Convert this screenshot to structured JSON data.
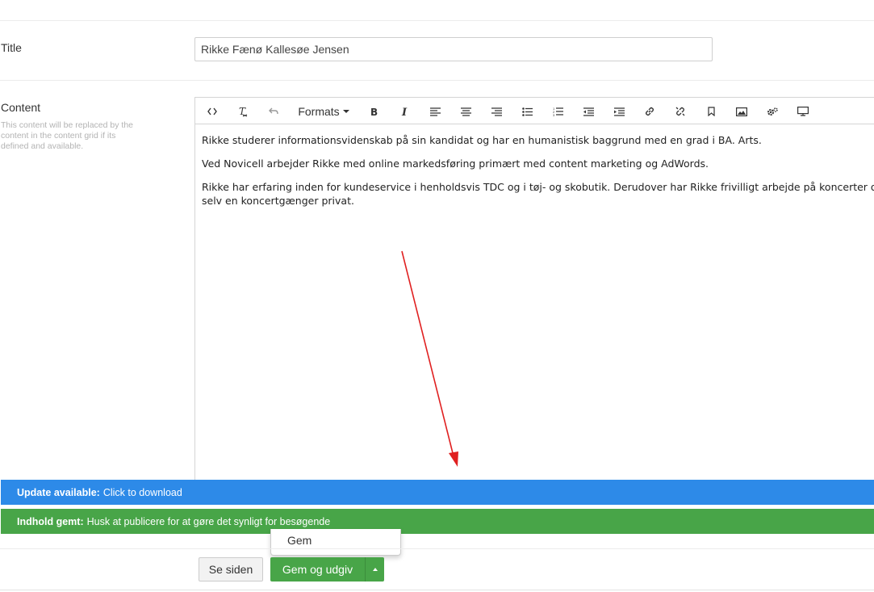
{
  "fields": {
    "title": {
      "label": "Title",
      "value": "Rikke Fænø Kallesøe Jensen"
    },
    "content": {
      "label": "Content",
      "description": "This content will be replaced by the content in the content grid if its defined and available.",
      "paragraphs": [
        "Rikke studerer informationsvidenskab på sin kandidat og har en humanistisk baggrund med en grad i BA. Arts.",
        "Ved Novicell arbejder Rikke med online markedsføring primært med content marketing og AdWords.",
        "Rikke har erfaring inden for kundeservice i henholdsvis TDC og i tøj- og skobutik. Derudover har Rikke frivilligt arbejde på koncerter og kultu",
        "selv en koncertgænger privat."
      ]
    }
  },
  "toolbar": {
    "formats_label": "Formats",
    "icons": [
      "code-icon",
      "clear-format-icon",
      "undo-icon",
      "bold-icon",
      "italic-icon",
      "align-left-icon",
      "align-center-icon",
      "align-right-icon",
      "bullet-list-icon",
      "numbered-list-icon",
      "outdent-icon",
      "indent-icon",
      "link-icon",
      "unlink-icon",
      "bookmark-icon",
      "image-icon",
      "settings-icon",
      "preview-icon"
    ]
  },
  "notifications": {
    "update": {
      "title": "Update available:",
      "text": "Click to download",
      "color": "#2d8ae8"
    },
    "saved": {
      "title": "Indhold gemt:",
      "text": "Husk at publicere for at gøre det synligt for besøgende",
      "color": "#48a548"
    }
  },
  "dropdown": {
    "item": "Gem"
  },
  "actions": {
    "preview_label": "Se siden",
    "save_publish_label": "Gem og udgiv"
  },
  "colors": {
    "accent_green": "#48a548",
    "accent_blue": "#2d8ae8",
    "arrow": "#e02020"
  }
}
